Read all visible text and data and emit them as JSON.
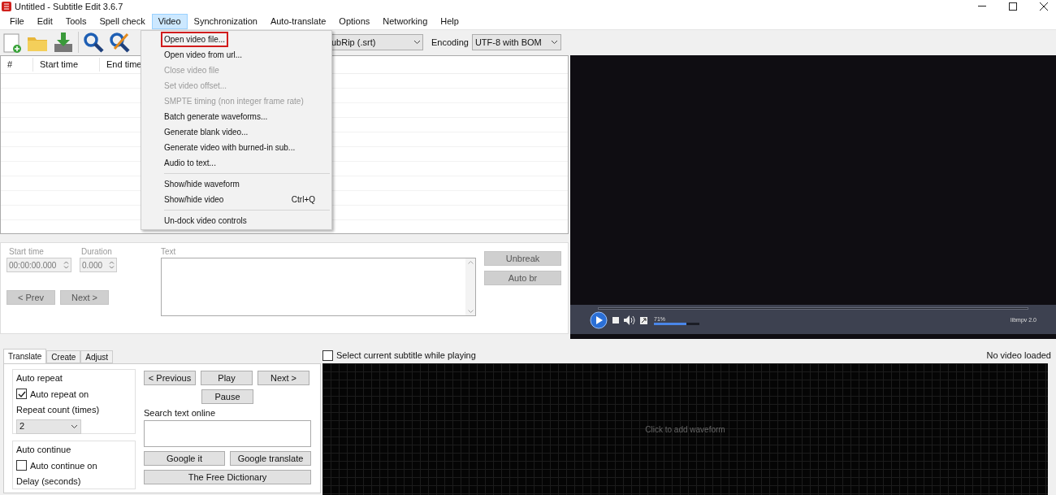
{
  "window": {
    "title": "Untitled - Subtitle Edit 3.6.7"
  },
  "menu": [
    {
      "label": "File",
      "selected": false
    },
    {
      "label": "Edit",
      "selected": false
    },
    {
      "label": "Tools",
      "selected": false
    },
    {
      "label": "Spell check",
      "selected": false
    },
    {
      "label": "Video",
      "selected": true
    },
    {
      "label": "Synchronization",
      "selected": false
    },
    {
      "label": "Auto-translate",
      "selected": false
    },
    {
      "label": "Options",
      "selected": false
    },
    {
      "label": "Networking",
      "selected": false
    },
    {
      "label": "Help",
      "selected": false
    }
  ],
  "toolbar": {
    "format": "ubRip (.srt)",
    "encoding_label": "Encoding",
    "encoding": "UTF-8 with BOM"
  },
  "video_menu": [
    {
      "kind": "item",
      "label": "Open video file...",
      "disabled": false,
      "highlighted": true
    },
    {
      "kind": "item",
      "label": "Open video from url...",
      "disabled": false,
      "highlighted": false
    },
    {
      "kind": "item",
      "label": "Close video file",
      "disabled": true,
      "highlighted": false
    },
    {
      "kind": "item",
      "label": "Set video offset...",
      "disabled": true,
      "highlighted": false
    },
    {
      "kind": "item",
      "label": "SMPTE timing (non integer frame rate)",
      "disabled": true,
      "highlighted": false
    },
    {
      "kind": "item",
      "label": "Batch generate waveforms...",
      "disabled": false,
      "highlighted": false
    },
    {
      "kind": "item",
      "label": "Generate blank video...",
      "disabled": false,
      "highlighted": false
    },
    {
      "kind": "item",
      "label": "Generate video with burned-in sub...",
      "disabled": false,
      "highlighted": false
    },
    {
      "kind": "item",
      "label": "Audio to text...",
      "disabled": false,
      "highlighted": false
    },
    {
      "kind": "separator"
    },
    {
      "kind": "item",
      "label": "Show/hide waveform",
      "disabled": false,
      "highlighted": false
    },
    {
      "kind": "item",
      "label": "Show/hide video",
      "shortcut": "Ctrl+Q",
      "disabled": false,
      "highlighted": false
    },
    {
      "kind": "separator"
    },
    {
      "kind": "item",
      "label": "Un-dock video controls",
      "disabled": false,
      "highlighted": false
    }
  ],
  "subtitle_list": {
    "columns": [
      "#",
      "Start time",
      "End time"
    ]
  },
  "editor": {
    "start_label": "Start time",
    "start_value": "00:00:00.000",
    "duration_label": "Duration",
    "duration_value": "0.000",
    "text_label": "Text",
    "buttons": [
      {
        "label": "< Prev",
        "disabled": true
      },
      {
        "label": "Next >",
        "disabled": true
      }
    ],
    "side_buttons": [
      {
        "label": "Unbreak",
        "disabled": true
      },
      {
        "label": "Auto br",
        "disabled": true
      }
    ]
  },
  "player": {
    "volume": {
      "reading": "71%",
      "level": 0.71
    },
    "engine": "libmpv 2.0"
  },
  "waveform": {
    "checkbox": {
      "label": "Select current subtitle while playing",
      "checked": false
    },
    "status": "No video loaded",
    "hint": "Click to add waveform"
  },
  "tabs": [
    {
      "label": "Translate",
      "selected": true
    },
    {
      "label": "Create",
      "selected": false
    },
    {
      "label": "Adjust",
      "selected": false
    }
  ],
  "translate": {
    "auto_repeat": {
      "title": "Auto repeat",
      "checkbox": {
        "label": "Auto repeat on",
        "checked": true
      },
      "count_label": "Repeat count (times)",
      "count": "2"
    },
    "auto_continue": {
      "title": "Auto continue",
      "checkbox": {
        "label": "Auto continue on",
        "checked": false
      },
      "delay_label": "Delay (seconds)"
    },
    "nav_buttons": [
      "< Previous",
      "Play",
      "Next >"
    ],
    "pause": "Pause",
    "search_label": "Search text online",
    "search_buttons": [
      "Google it",
      "Google translate"
    ],
    "dictionary": "The Free Dictionary"
  }
}
